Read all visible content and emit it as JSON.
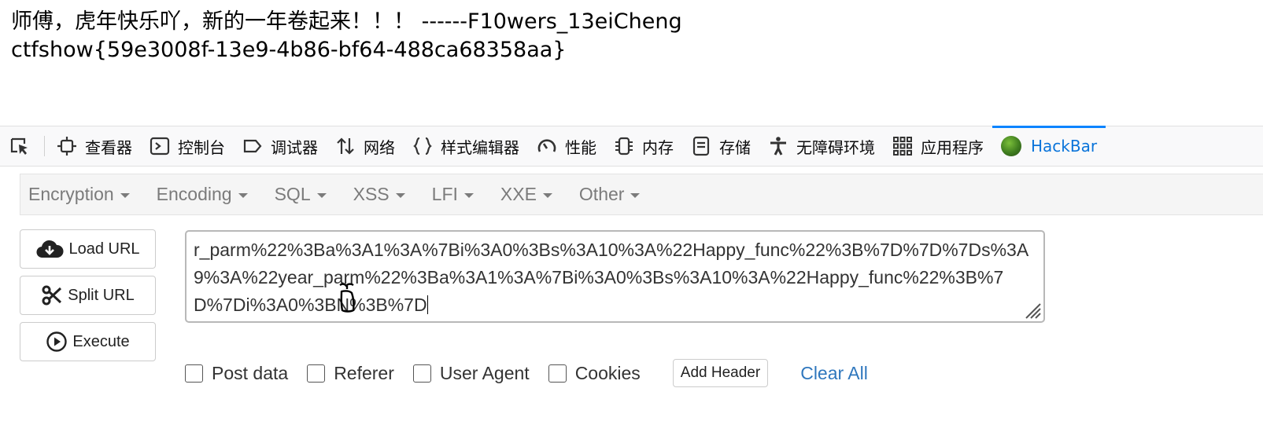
{
  "page": {
    "line1": "师傅，虎年快乐吖，新的一年卷起来！！！ ------F10wers_13eiCheng",
    "line2": "ctfshow{59e3008f-13e9-4b86-bf64-488ca68358aa}"
  },
  "devtools": {
    "tabs": [
      {
        "label": "查看器",
        "icon": "inspector-icon"
      },
      {
        "label": "控制台",
        "icon": "console-icon"
      },
      {
        "label": "调试器",
        "icon": "debugger-icon"
      },
      {
        "label": "网络",
        "icon": "network-icon"
      },
      {
        "label": "样式编辑器",
        "icon": "style-editor-icon"
      },
      {
        "label": "性能",
        "icon": "performance-icon"
      },
      {
        "label": "内存",
        "icon": "memory-icon"
      },
      {
        "label": "存储",
        "icon": "storage-icon"
      },
      {
        "label": "无障碍环境",
        "icon": "accessibility-icon"
      },
      {
        "label": "应用程序",
        "icon": "application-icon"
      },
      {
        "label": "HackBar",
        "icon": "hackbar-logo-icon",
        "active": true
      }
    ],
    "active_color": "#0a74da"
  },
  "hackbar": {
    "menu": [
      "Encryption",
      "Encoding",
      "SQL",
      "XSS",
      "LFI",
      "XXE",
      "Other"
    ],
    "buttons": {
      "load_url": "Load URL",
      "split_url": "Split URL",
      "execute": "Execute"
    },
    "url_value": "r_parm%22%3Ba%3A1%3A%7Bi%3A0%3Bs%3A10%3A%22Happy_func%22%3B%7D%7D%7Ds%3A9%3A%22year_parm%22%3Ba%3A1%3A%7Bi%3A0%3Bs%3A10%3A%22Happy_func%22%3B%7D%7Di%3A0%3BN%3B%7D",
    "options": {
      "post_data": "Post data",
      "referer": "Referer",
      "user_agent": "User Agent",
      "cookies": "Cookies"
    },
    "add_header": "Add Header",
    "clear_all": "Clear All",
    "link_color": "#2f77bd"
  }
}
